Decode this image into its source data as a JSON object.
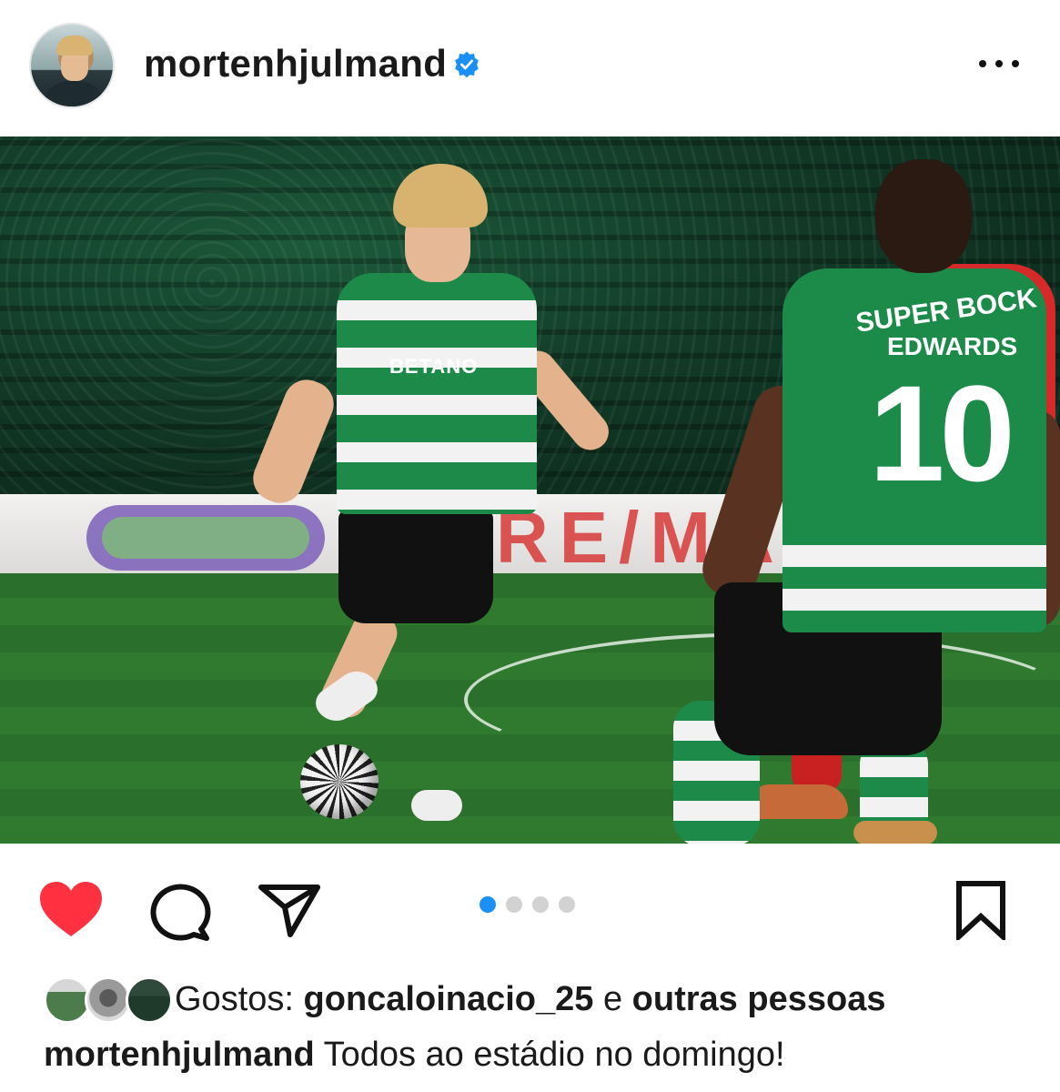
{
  "post": {
    "username": "mortenhjulmand",
    "verified": true,
    "more_icon": "more-horizontal-icon",
    "photo_description_alt": "",
    "carousel": {
      "count": 4,
      "active_index": 0
    },
    "photo_texts": {
      "sponsor": "BETANO",
      "player_name": "EDWARDS",
      "shirt_sponsor_back": "SUPER BOCK",
      "number": "10",
      "board_text": "RE/MA"
    }
  },
  "actions": {
    "like_icon": "heart-icon",
    "liked": true,
    "comment_icon": "comment-icon",
    "share_icon": "send-icon",
    "save_icon": "bookmark-icon"
  },
  "likes": {
    "prefix": "Gostos:",
    "user": "goncaloinacio_25",
    "joiner": "e",
    "others": "outras pessoas"
  },
  "caption": {
    "username": "mortenhjulmand",
    "text": "Todos ao estádio no domingo!"
  },
  "colors": {
    "like_red": "#ff3040",
    "verified_blue": "#1a8ff5",
    "dot_active": "#1a8ff5",
    "dot_inactive": "#d2d2d2",
    "sporting_green": "#1e8a4a"
  }
}
